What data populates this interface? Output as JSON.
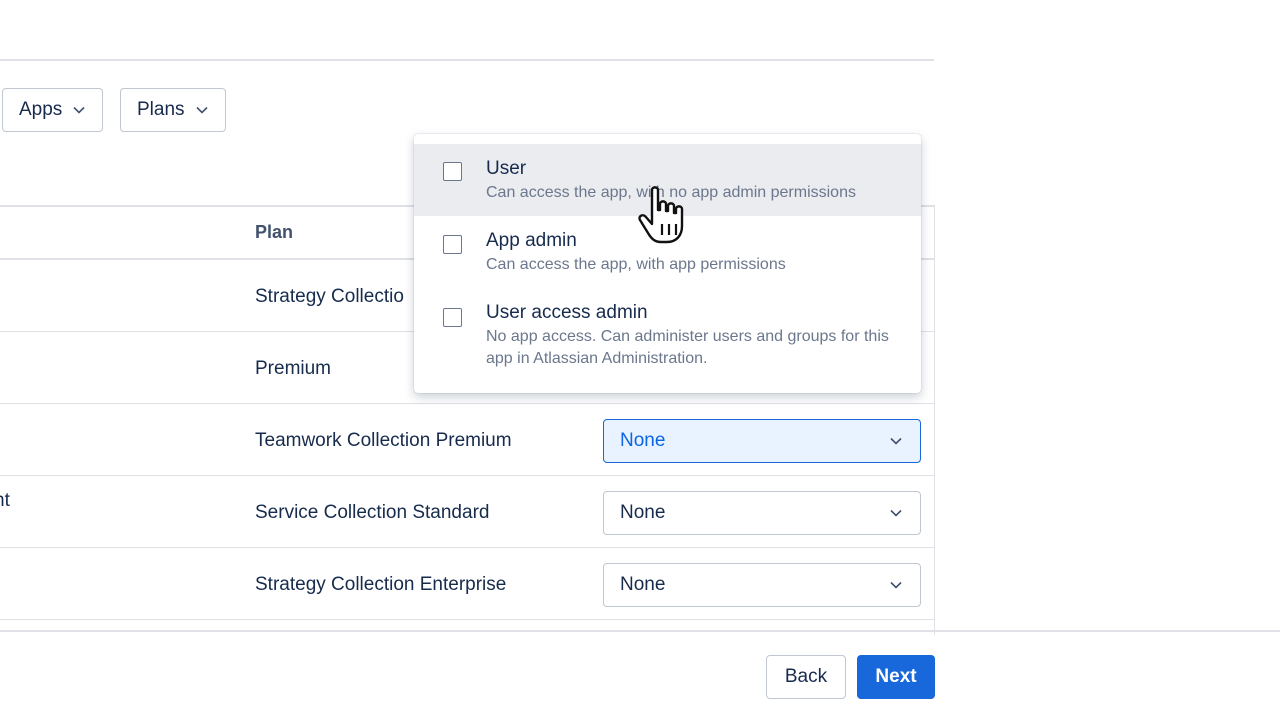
{
  "filters": {
    "apps_label": "Apps",
    "plans_label": "Plans"
  },
  "table": {
    "plan_header": "Plan",
    "partial_text": "nt",
    "rows": [
      {
        "plan": "Strategy Collectio"
      },
      {
        "plan": "Premium"
      },
      {
        "plan": "Teamwork Collection Premium",
        "role": "None"
      },
      {
        "plan": "Service Collection Standard",
        "role": "None"
      },
      {
        "plan": "Strategy Collection Enterprise",
        "role": "None"
      }
    ]
  },
  "dropdown": {
    "options": [
      {
        "title": "User",
        "description": "Can access the app, with no app admin permissions"
      },
      {
        "title": "App admin",
        "description": "Can access the app, with app permissions"
      },
      {
        "title": "User access admin",
        "description": "No app access. Can administer users and groups for this app in Atlassian Administration."
      }
    ]
  },
  "footer": {
    "back_label": "Back",
    "next_label": "Next"
  },
  "colors": {
    "accent": "#1868db",
    "active_select_bg": "#e9f2ff",
    "hover_bg": "#ebecf0",
    "border": "#c1c7d0",
    "text": "#172b4d",
    "muted_text": "#6b778c"
  },
  "icons": {
    "filter_chevron": "chevron-down-icon",
    "select_chevron": "chevron-down-icon",
    "pointer": "hand-pointer-icon"
  }
}
